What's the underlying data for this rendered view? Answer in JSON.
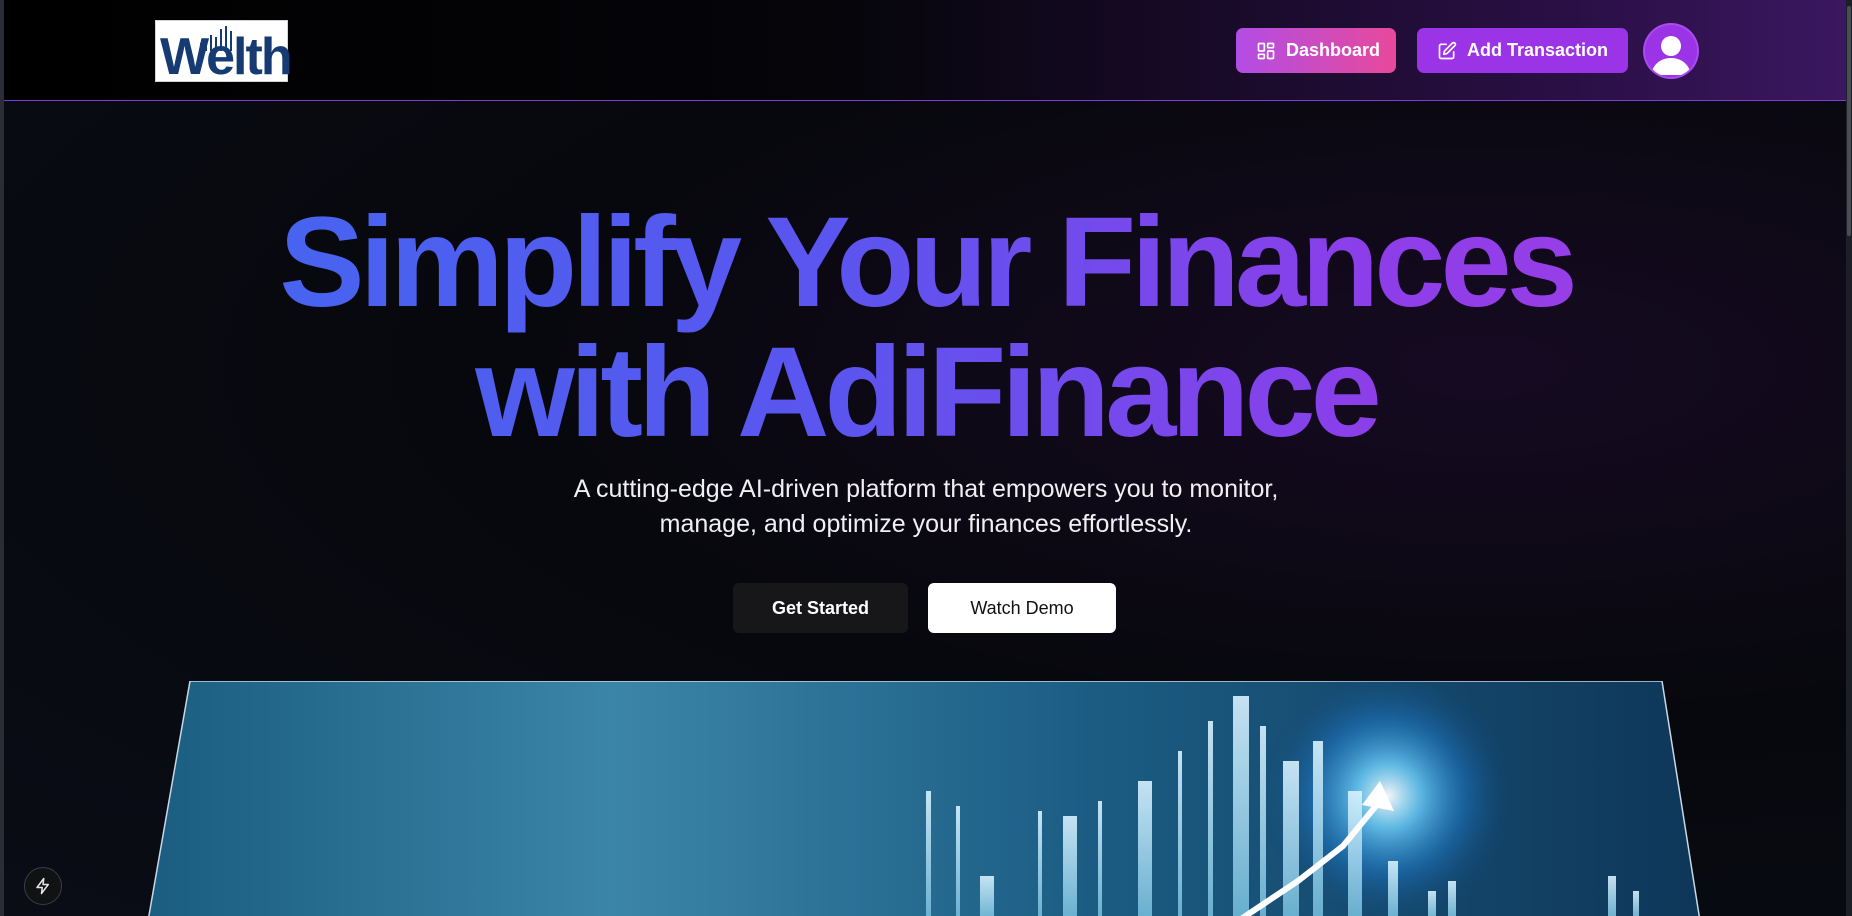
{
  "header": {
    "logo_text": "Welth",
    "dashboard_label": "Dashboard",
    "add_transaction_label": "Add Transaction",
    "icons": {
      "dashboard": "layout-dashboard-icon",
      "add_transaction": "pen-square-icon",
      "avatar": "user-avatar-icon"
    }
  },
  "hero": {
    "title_line1": "Simplify Your Finances",
    "title_line2": "with AdiFinance",
    "subtitle_line1": "A cutting-edge AI-driven platform that empowers you to monitor,",
    "subtitle_line2": "manage, and optimize your finances effortlessly.",
    "get_started_label": "Get Started",
    "watch_demo_label": "Watch Demo"
  },
  "banner": {
    "image": "financial-growth-chart-image"
  },
  "fab": {
    "icon": "lightning-bolt-icon"
  },
  "colors": {
    "gradient_start": "#3d6bf0",
    "gradient_end": "#a43fe6",
    "dashboard_btn_start": "#b24de5",
    "dashboard_btn_end": "#e8499a",
    "add_btn": "#9b33e6"
  }
}
